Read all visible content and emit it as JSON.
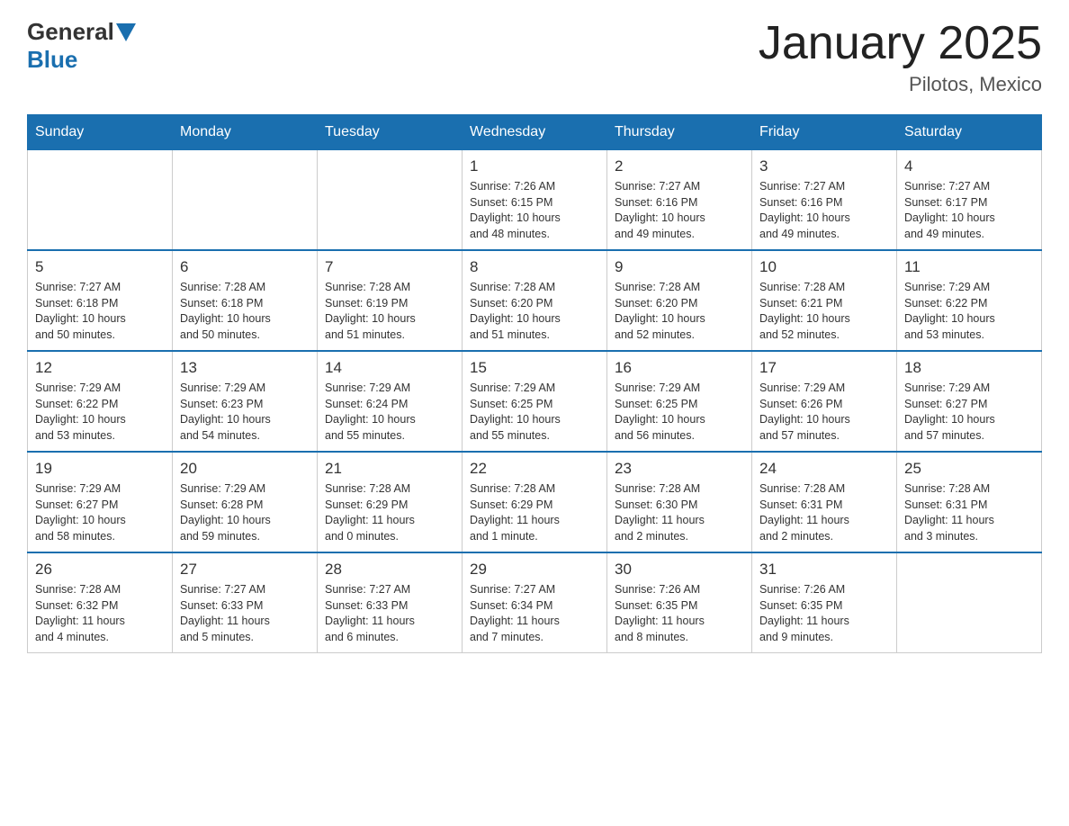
{
  "header": {
    "logo_general": "General",
    "logo_blue": "Blue",
    "month_year": "January 2025",
    "location": "Pilotos, Mexico"
  },
  "days_of_week": [
    "Sunday",
    "Monday",
    "Tuesday",
    "Wednesday",
    "Thursday",
    "Friday",
    "Saturday"
  ],
  "weeks": [
    [
      {
        "num": "",
        "info": ""
      },
      {
        "num": "",
        "info": ""
      },
      {
        "num": "",
        "info": ""
      },
      {
        "num": "1",
        "info": "Sunrise: 7:26 AM\nSunset: 6:15 PM\nDaylight: 10 hours\nand 48 minutes."
      },
      {
        "num": "2",
        "info": "Sunrise: 7:27 AM\nSunset: 6:16 PM\nDaylight: 10 hours\nand 49 minutes."
      },
      {
        "num": "3",
        "info": "Sunrise: 7:27 AM\nSunset: 6:16 PM\nDaylight: 10 hours\nand 49 minutes."
      },
      {
        "num": "4",
        "info": "Sunrise: 7:27 AM\nSunset: 6:17 PM\nDaylight: 10 hours\nand 49 minutes."
      }
    ],
    [
      {
        "num": "5",
        "info": "Sunrise: 7:27 AM\nSunset: 6:18 PM\nDaylight: 10 hours\nand 50 minutes."
      },
      {
        "num": "6",
        "info": "Sunrise: 7:28 AM\nSunset: 6:18 PM\nDaylight: 10 hours\nand 50 minutes."
      },
      {
        "num": "7",
        "info": "Sunrise: 7:28 AM\nSunset: 6:19 PM\nDaylight: 10 hours\nand 51 minutes."
      },
      {
        "num": "8",
        "info": "Sunrise: 7:28 AM\nSunset: 6:20 PM\nDaylight: 10 hours\nand 51 minutes."
      },
      {
        "num": "9",
        "info": "Sunrise: 7:28 AM\nSunset: 6:20 PM\nDaylight: 10 hours\nand 52 minutes."
      },
      {
        "num": "10",
        "info": "Sunrise: 7:28 AM\nSunset: 6:21 PM\nDaylight: 10 hours\nand 52 minutes."
      },
      {
        "num": "11",
        "info": "Sunrise: 7:29 AM\nSunset: 6:22 PM\nDaylight: 10 hours\nand 53 minutes."
      }
    ],
    [
      {
        "num": "12",
        "info": "Sunrise: 7:29 AM\nSunset: 6:22 PM\nDaylight: 10 hours\nand 53 minutes."
      },
      {
        "num": "13",
        "info": "Sunrise: 7:29 AM\nSunset: 6:23 PM\nDaylight: 10 hours\nand 54 minutes."
      },
      {
        "num": "14",
        "info": "Sunrise: 7:29 AM\nSunset: 6:24 PM\nDaylight: 10 hours\nand 55 minutes."
      },
      {
        "num": "15",
        "info": "Sunrise: 7:29 AM\nSunset: 6:25 PM\nDaylight: 10 hours\nand 55 minutes."
      },
      {
        "num": "16",
        "info": "Sunrise: 7:29 AM\nSunset: 6:25 PM\nDaylight: 10 hours\nand 56 minutes."
      },
      {
        "num": "17",
        "info": "Sunrise: 7:29 AM\nSunset: 6:26 PM\nDaylight: 10 hours\nand 57 minutes."
      },
      {
        "num": "18",
        "info": "Sunrise: 7:29 AM\nSunset: 6:27 PM\nDaylight: 10 hours\nand 57 minutes."
      }
    ],
    [
      {
        "num": "19",
        "info": "Sunrise: 7:29 AM\nSunset: 6:27 PM\nDaylight: 10 hours\nand 58 minutes."
      },
      {
        "num": "20",
        "info": "Sunrise: 7:29 AM\nSunset: 6:28 PM\nDaylight: 10 hours\nand 59 minutes."
      },
      {
        "num": "21",
        "info": "Sunrise: 7:28 AM\nSunset: 6:29 PM\nDaylight: 11 hours\nand 0 minutes."
      },
      {
        "num": "22",
        "info": "Sunrise: 7:28 AM\nSunset: 6:29 PM\nDaylight: 11 hours\nand 1 minute."
      },
      {
        "num": "23",
        "info": "Sunrise: 7:28 AM\nSunset: 6:30 PM\nDaylight: 11 hours\nand 2 minutes."
      },
      {
        "num": "24",
        "info": "Sunrise: 7:28 AM\nSunset: 6:31 PM\nDaylight: 11 hours\nand 2 minutes."
      },
      {
        "num": "25",
        "info": "Sunrise: 7:28 AM\nSunset: 6:31 PM\nDaylight: 11 hours\nand 3 minutes."
      }
    ],
    [
      {
        "num": "26",
        "info": "Sunrise: 7:28 AM\nSunset: 6:32 PM\nDaylight: 11 hours\nand 4 minutes."
      },
      {
        "num": "27",
        "info": "Sunrise: 7:27 AM\nSunset: 6:33 PM\nDaylight: 11 hours\nand 5 minutes."
      },
      {
        "num": "28",
        "info": "Sunrise: 7:27 AM\nSunset: 6:33 PM\nDaylight: 11 hours\nand 6 minutes."
      },
      {
        "num": "29",
        "info": "Sunrise: 7:27 AM\nSunset: 6:34 PM\nDaylight: 11 hours\nand 7 minutes."
      },
      {
        "num": "30",
        "info": "Sunrise: 7:26 AM\nSunset: 6:35 PM\nDaylight: 11 hours\nand 8 minutes."
      },
      {
        "num": "31",
        "info": "Sunrise: 7:26 AM\nSunset: 6:35 PM\nDaylight: 11 hours\nand 9 minutes."
      },
      {
        "num": "",
        "info": ""
      }
    ]
  ]
}
